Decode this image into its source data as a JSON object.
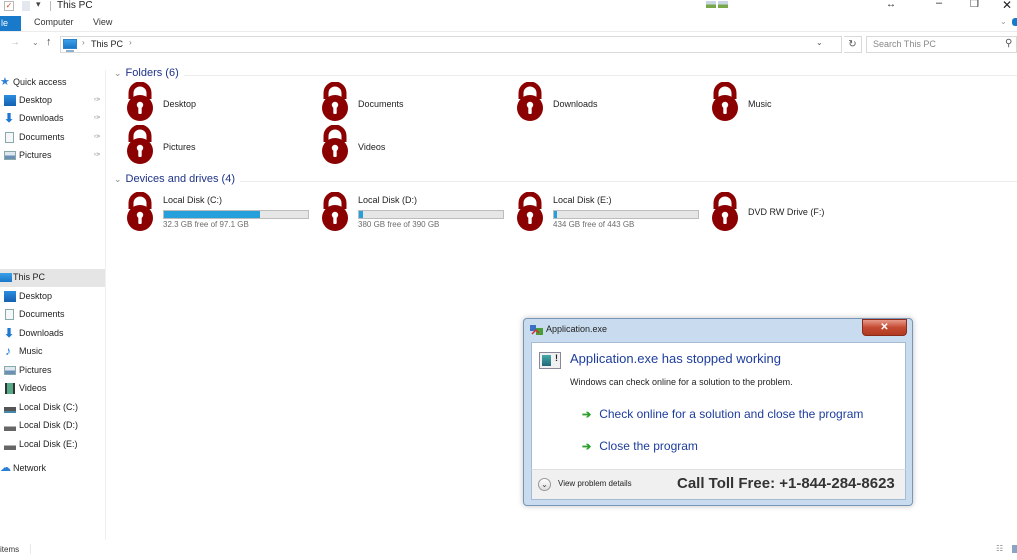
{
  "window": {
    "title": "This PC",
    "controls": {
      "resize": "↔",
      "minimize": "–",
      "maximize": "❐",
      "close": "✕"
    }
  },
  "ribbon": {
    "file_label": "le",
    "tabs": [
      "Computer",
      "View"
    ],
    "expand": "⌄"
  },
  "address": {
    "path": "This PC",
    "separator": "›",
    "dropdown": "⌄",
    "refresh": "↻",
    "search_placeholder": "Search This PC",
    "search_icon": "⚲"
  },
  "sidebar": {
    "quick_access": {
      "label": "Quick access",
      "items": [
        {
          "label": "Desktop",
          "icon": "desktop-icon",
          "pinned": true
        },
        {
          "label": "Downloads",
          "icon": "downloads-icon",
          "pinned": true
        },
        {
          "label": "Documents",
          "icon": "documents-icon",
          "pinned": true
        },
        {
          "label": "Pictures",
          "icon": "pictures-icon",
          "pinned": true
        }
      ]
    },
    "this_pc": {
      "label": "This PC",
      "selected": true,
      "items": [
        {
          "label": "Desktop",
          "icon": "desktop-icon"
        },
        {
          "label": "Documents",
          "icon": "documents-icon"
        },
        {
          "label": "Downloads",
          "icon": "downloads-icon"
        },
        {
          "label": "Music",
          "icon": "music-icon"
        },
        {
          "label": "Pictures",
          "icon": "pictures-icon"
        },
        {
          "label": "Videos",
          "icon": "videos-icon"
        },
        {
          "label": "Local Disk (C:)",
          "icon": "disk-icon"
        },
        {
          "label": "Local Disk (D:)",
          "icon": "disk-icon"
        },
        {
          "label": "Local Disk (E:)",
          "icon": "disk-icon"
        }
      ]
    },
    "network": {
      "label": "Network",
      "icon": "network-icon"
    },
    "pin_glyph": "📌"
  },
  "folders": {
    "header": "Folders (6)",
    "items": [
      {
        "name": "Desktop",
        "icon": "lock-icon"
      },
      {
        "name": "Documents",
        "icon": "lock-icon"
      },
      {
        "name": "Downloads",
        "icon": "lock-icon"
      },
      {
        "name": "Music",
        "icon": "lock-icon"
      },
      {
        "name": "Pictures",
        "icon": "lock-icon"
      },
      {
        "name": "Videos",
        "icon": "lock-icon"
      }
    ]
  },
  "drives": {
    "header": "Devices and drives (4)",
    "items": [
      {
        "name": "Local Disk (C:)",
        "free_text": "32.3 GB free of 97.1 GB",
        "used_fraction": 0.667
      },
      {
        "name": "Local Disk (D:)",
        "free_text": "380 GB free of 390 GB",
        "used_fraction": 0.026
      },
      {
        "name": "Local Disk (E:)",
        "free_text": "434 GB free of 443 GB",
        "used_fraction": 0.02
      },
      {
        "name": "DVD RW Drive (F:)"
      }
    ]
  },
  "dialog": {
    "title": "Application.exe",
    "close": "✕",
    "heading": "Application.exe has stopped working",
    "subtext": "Windows can check online for a solution to the problem.",
    "options": [
      "Check online for a solution and close the program",
      "Close the program"
    ],
    "option_arrow": "➔",
    "details_label": "View problem details",
    "details_chevron": "⌄",
    "phone_text": "Call Toll Free: +1-844-284-8623"
  },
  "statusbar": {
    "items_text": "items"
  },
  "colors": {
    "lock": "#8b0000",
    "accent": "#1979ca",
    "drive_fill": "#26a0da",
    "heading_blue": "#1e3d9c"
  }
}
